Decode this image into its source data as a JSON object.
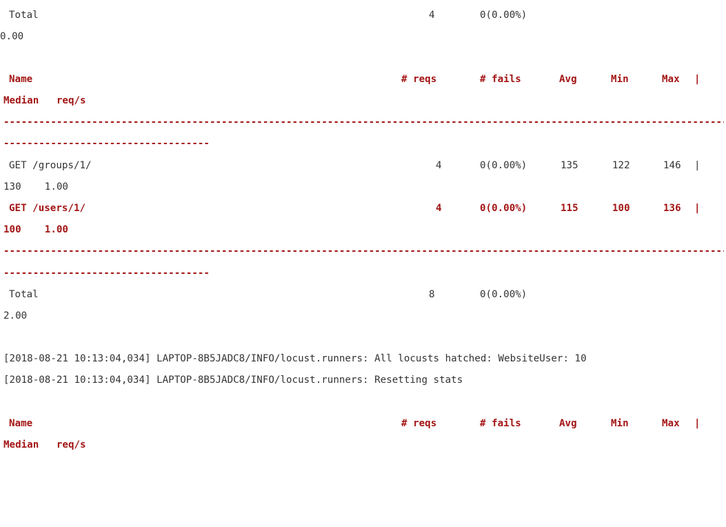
{
  "colors": {
    "header": "#a31515",
    "text": "#333333",
    "background": "#ffffff"
  },
  "block1": {
    "total_row": {
      "name": "Total",
      "reqs": "4",
      "fails": "0(0.00%)",
      "wrap": "0.00"
    }
  },
  "header": {
    "name": "Name",
    "reqs": "# reqs",
    "fails": "# fails",
    "avg": "Avg",
    "min": "Min",
    "max": "Max",
    "bar": "|",
    "wrap": "Median   req/s"
  },
  "separator": {
    "long": "---------------------------------------------------------------------------------------------------------------------------------------------",
    "short": "-----------------------------------"
  },
  "block2": {
    "rows": [
      {
        "name": "GET /groups/1/",
        "reqs": "4",
        "fails": "0(0.00%)",
        "avg": "135",
        "min": "122",
        "max": "146",
        "bar": "|",
        "wrap": "130    1.00"
      },
      {
        "name": "GET /users/1/",
        "reqs": "4",
        "fails": "0(0.00%)",
        "avg": "115",
        "min": "100",
        "max": "136",
        "bar": "|",
        "wrap": "100    1.00"
      }
    ],
    "total_row": {
      "name": "Total",
      "reqs": "8",
      "fails": "0(0.00%)",
      "wrap": "2.00"
    }
  },
  "log": {
    "line1": "[2018-08-21 10:13:04,034] LAPTOP-8B5JADC8/INFO/locust.runners: All locusts hatched: WebsiteUser: 10",
    "line2": "[2018-08-21 10:13:04,034] LAPTOP-8B5JADC8/INFO/locust.runners: Resetting stats"
  }
}
